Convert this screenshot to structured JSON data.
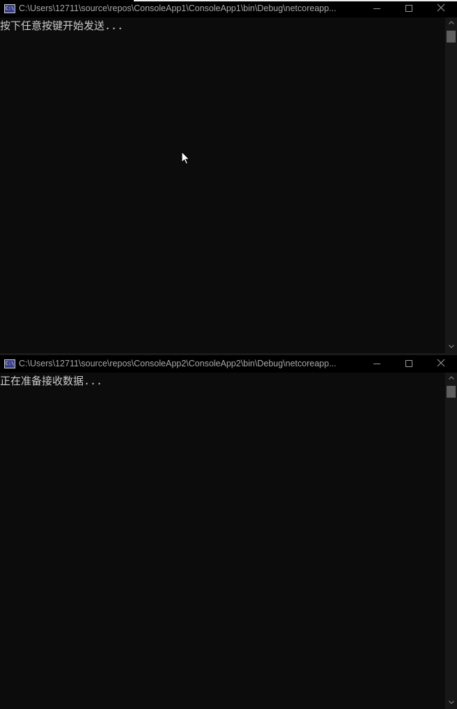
{
  "windows": [
    {
      "icon_text": "C:\\",
      "title": "C:\\Users\\12711\\source\\repos\\ConsoleApp1\\ConsoleApp1\\bin\\Debug\\netcoreapp...",
      "output": "按下任意按键开始发送..."
    },
    {
      "icon_text": "C:\\",
      "title": "C:\\Users\\12711\\source\\repos\\ConsoleApp2\\ConsoleApp2\\bin\\Debug\\netcoreapp...",
      "output": "正在准备接收数据..."
    }
  ],
  "colors": {
    "console_background": "#0c0c0c",
    "console_text": "#cccccc",
    "titlebar_background": "#000000",
    "titlebar_text": "#a8a8a8",
    "scrollbar_track": "#171717",
    "scrollbar_thumb": "#5e5e5e"
  },
  "icons": {
    "app": "console-app-icon",
    "minimize": "minimize-icon",
    "maximize": "maximize-icon",
    "close": "close-icon",
    "scroll_up": "chevron-up-icon",
    "scroll_down": "chevron-down-icon",
    "pointer": "mouse-cursor-icon"
  }
}
